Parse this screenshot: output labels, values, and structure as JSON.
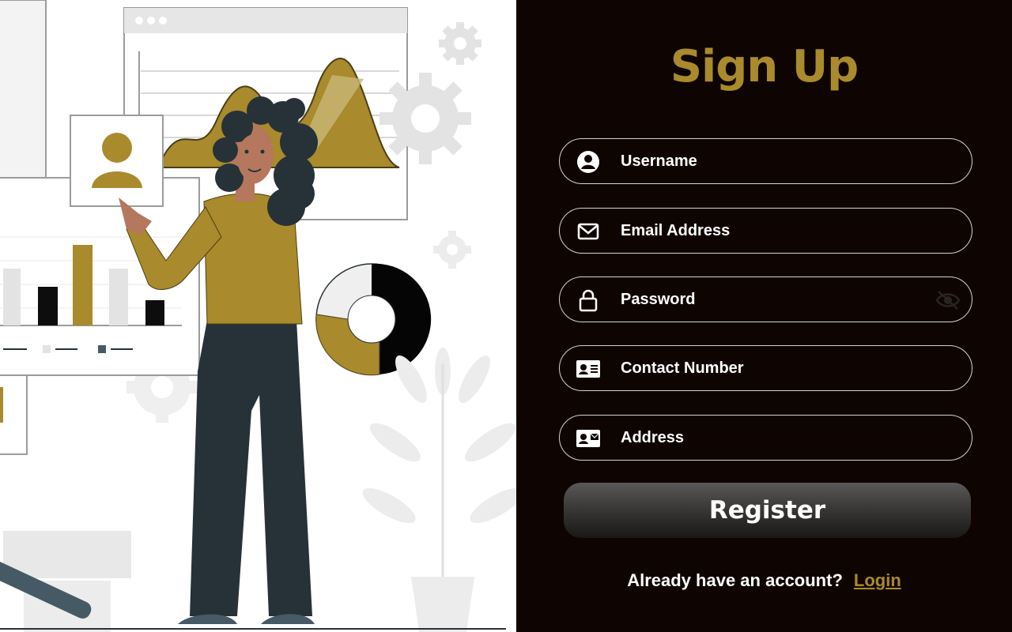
{
  "form": {
    "title": "Sign Up",
    "fields": [
      {
        "placeholder": "Username",
        "icon": "user-circle-icon"
      },
      {
        "placeholder": "Email Address",
        "icon": "envelope-icon"
      },
      {
        "placeholder": "Password",
        "icon": "lock-icon",
        "trailing_icon": "eye-slash-icon"
      },
      {
        "placeholder": "Contact Number",
        "icon": "id-card-icon"
      },
      {
        "placeholder": "Address",
        "icon": "address-card-icon"
      }
    ],
    "register_label": "Register",
    "footer_text": "Already have an account?",
    "login_label": "Login"
  },
  "colors": {
    "accent": "#a98a2c",
    "panel_background": "#0e0503",
    "figure_dark": "#263238"
  }
}
